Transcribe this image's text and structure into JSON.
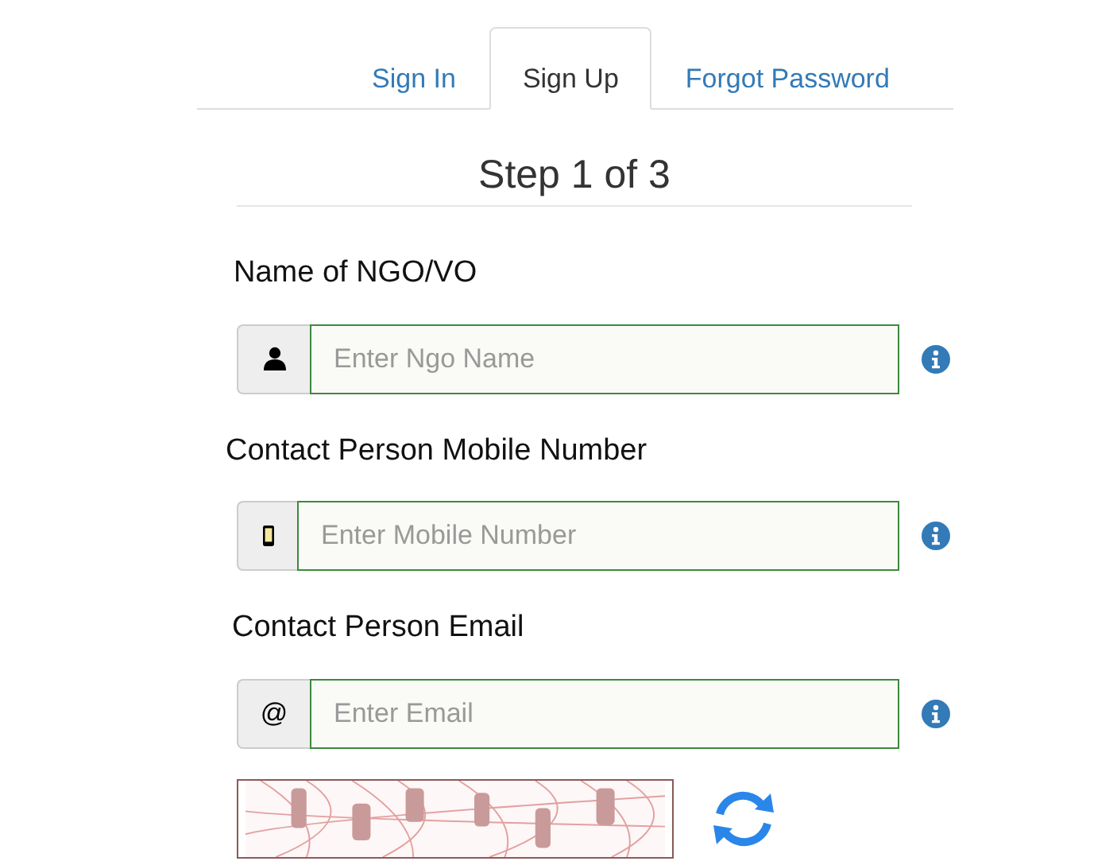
{
  "tabs": [
    {
      "label": "Sign In",
      "selected": false
    },
    {
      "label": "Sign Up",
      "selected": true
    },
    {
      "label": "Forgot Password",
      "selected": false
    }
  ],
  "step_title": "Step 1 of 3",
  "fields": [
    {
      "label": "Name of NGO/VO",
      "kind": "user",
      "placeholder": "Enter Ngo Name"
    },
    {
      "label": "Contact Person Mobile Number",
      "kind": "phone",
      "placeholder": "Enter Mobile Number"
    },
    {
      "label": "Contact Person Email",
      "kind": "text",
      "addon": "@",
      "placeholder": "Enter Email"
    }
  ]
}
